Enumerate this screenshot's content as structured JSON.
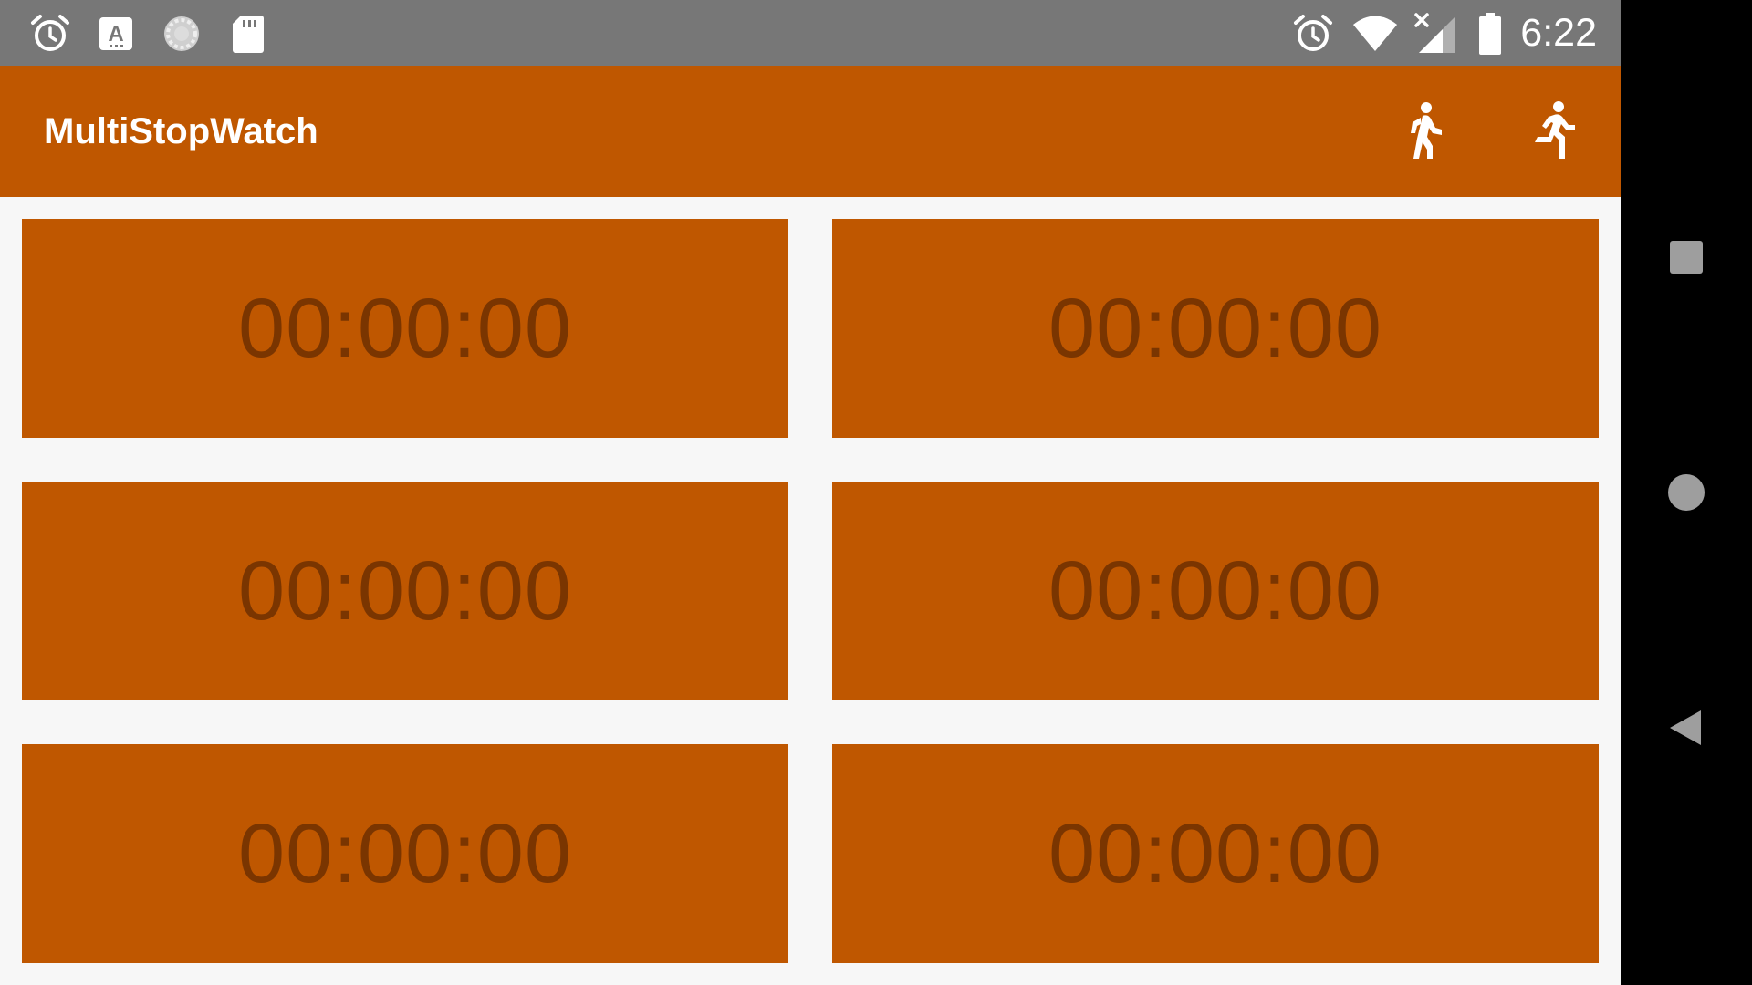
{
  "status_bar": {
    "time": "6:22",
    "left_icons": [
      "alarm-icon",
      "keyboard-a-icon",
      "sync-icon",
      "sd-card-icon"
    ],
    "right_icons": [
      "alarm-icon",
      "wifi-icon",
      "cell-signal-off-icon",
      "battery-icon"
    ]
  },
  "app_bar": {
    "title": "MultiStopWatch",
    "actions": [
      {
        "name": "walk-action",
        "icon": "walk-icon"
      },
      {
        "name": "run-action",
        "icon": "run-icon"
      }
    ]
  },
  "stopwatches": [
    {
      "time": "00:00:00"
    },
    {
      "time": "00:00:00"
    },
    {
      "time": "00:00:00"
    },
    {
      "time": "00:00:00"
    },
    {
      "time": "00:00:00"
    },
    {
      "time": "00:00:00"
    }
  ],
  "nav_bar": {
    "buttons": [
      "recents-icon",
      "home-icon",
      "back-icon"
    ]
  },
  "colors": {
    "primary": "#bf5700",
    "timer_text": "#7a3500",
    "status_bar": "#777777",
    "background": "#f7f7f7",
    "nav_bar": "#000000"
  }
}
